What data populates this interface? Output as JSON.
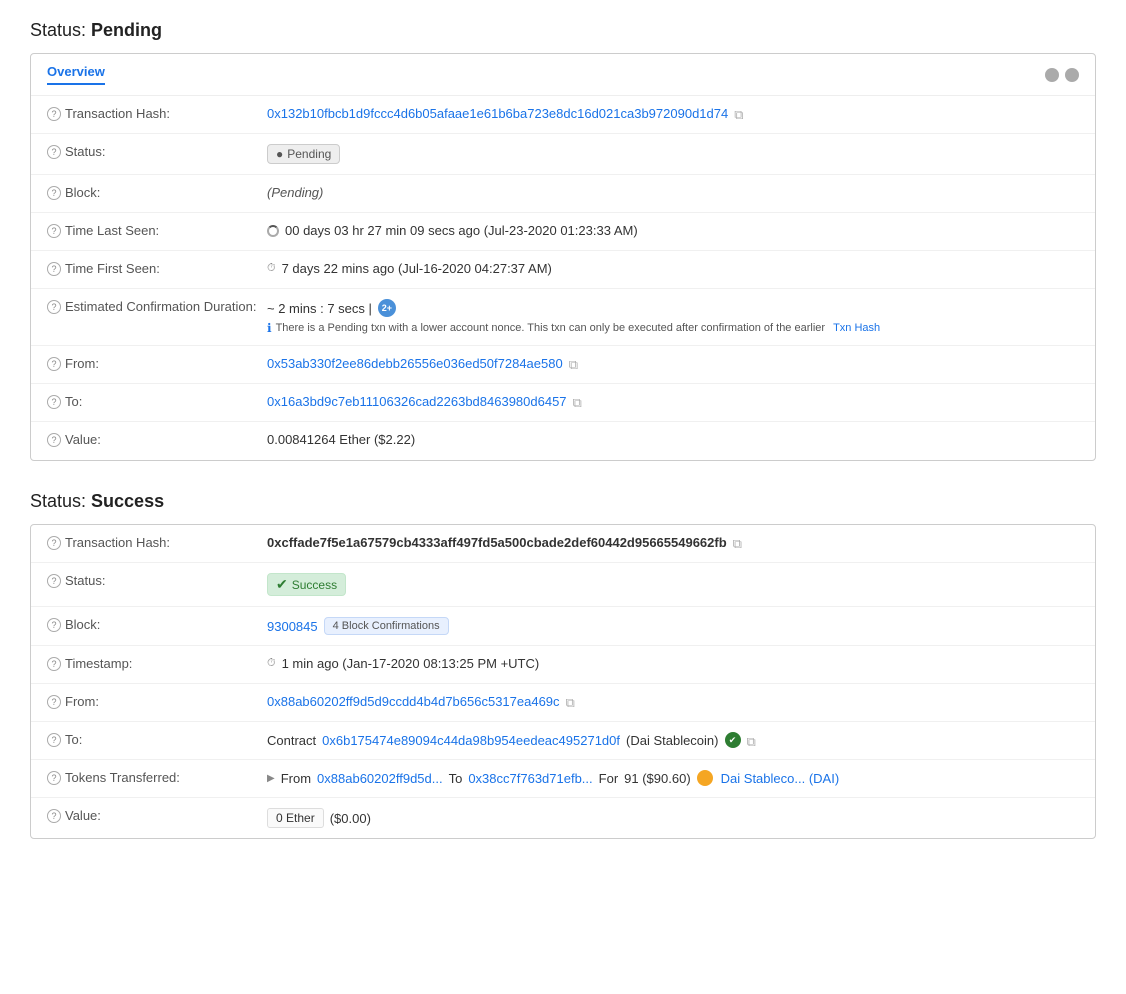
{
  "pending_section": {
    "title": "Status: ",
    "title_bold": "Pending",
    "tab": "Overview",
    "rows": [
      {
        "label": "Transaction Hash:",
        "type": "hash_copy",
        "value": "0x132b10fbcb1d9fccc4d6b05afaae1e61b6ba723e8dc16d021ca3b972090d1d74"
      },
      {
        "label": "Status:",
        "type": "badge_pending",
        "value": "Pending"
      },
      {
        "label": "Block:",
        "type": "italic",
        "value": "(Pending)"
      },
      {
        "label": "Time Last Seen:",
        "type": "time",
        "value": "00 days 03 hr 27 min 09 secs ago (Jul-23-2020 01:23:33 AM)"
      },
      {
        "label": "Time First Seen:",
        "type": "time2",
        "value": "7 days 22 mins ago (Jul-16-2020 04:27:37 AM)"
      },
      {
        "label": "Estimated Confirmation Duration:",
        "type": "est_confirm",
        "main": "~ 2 mins : 7 secs |",
        "sub": "There is a Pending txn with a lower account nonce. This txn can only be executed after confirmation of the earlier",
        "txn_link": "Txn Hash"
      },
      {
        "label": "From:",
        "type": "link_copy",
        "value": "0x53ab330f2ee86debb26556e036ed50f7284ae580"
      },
      {
        "label": "To:",
        "type": "link_copy",
        "value": "0x16a3bd9c7eb11106326cad2263bd8463980d6457"
      },
      {
        "label": "Value:",
        "type": "plain",
        "value": "0.00841264 Ether ($2.22)"
      }
    ]
  },
  "success_section": {
    "title": "Status: ",
    "title_bold": "Success",
    "rows": [
      {
        "label": "Transaction Hash:",
        "type": "hash_bold_copy",
        "value": "0xcffade7f5e1a67579cb4333aff497fd5a500cbade2def60442d95665549662fb"
      },
      {
        "label": "Status:",
        "type": "badge_success",
        "value": "Success"
      },
      {
        "label": "Block:",
        "type": "block",
        "block_num": "9300845",
        "confirmations": "4 Block Confirmations"
      },
      {
        "label": "Timestamp:",
        "type": "timestamp",
        "value": "1 min ago (Jan-17-2020 08:13:25 PM +UTC)"
      },
      {
        "label": "From:",
        "type": "link_copy",
        "value": "0x88ab60202ff9d5d9ccdd4b4d7b656c5317ea469c"
      },
      {
        "label": "To:",
        "type": "to_contract",
        "prefix": "Contract",
        "contract_addr": "0x6b175474e89094c44da98b954eedeac495271d0f",
        "contract_name": "(Dai Stablecoin)"
      },
      {
        "label": "Tokens Transferred:",
        "type": "tokens",
        "from_addr": "0x88ab60202ff9d5d...",
        "to_addr": "0x38cc7f763d71efb...",
        "amount": "91 ($90.60)",
        "token_name": "Dai Stableco... (DAI)"
      },
      {
        "label": "Value:",
        "type": "value_box",
        "ether": "0 Ether",
        "usd": "($0.00)"
      }
    ]
  },
  "labels": {
    "help": "?",
    "copy": "⧉",
    "clock": "⏱",
    "check": "✔",
    "arrow": "▶"
  }
}
